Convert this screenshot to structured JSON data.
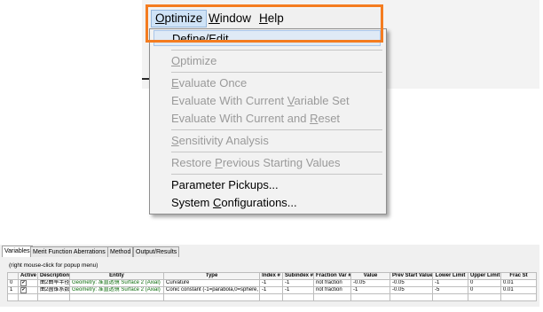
{
  "menubar": {
    "items": [
      {
        "mnemonic": "O",
        "rest": "ptimize",
        "active": true
      },
      {
        "mnemonic": "W",
        "rest": "indow",
        "active": false
      },
      {
        "mnemonic": "H",
        "rest": "elp",
        "active": false
      }
    ]
  },
  "dropdown": {
    "define_edit": "Define/Edit...",
    "optimize": {
      "mnemonic": "O",
      "rest": "ptimize"
    },
    "evaluate_once": {
      "mnemonic": "E",
      "rest": "valuate Once"
    },
    "evaluate_current_variable_set": {
      "pre": "Evaluate With Current ",
      "mnemonic": "V",
      "rest": "ariable Set"
    },
    "evaluate_current_reset": {
      "pre": "Evaluate With Current and ",
      "mnemonic": "R",
      "rest": "eset"
    },
    "sensitivity_analysis": {
      "mnemonic": "S",
      "rest": "ensitivity Analysis"
    },
    "restore_previous": {
      "pre": "Restore ",
      "mnemonic": "P",
      "rest": "revious Starting Values"
    },
    "parameter_pickups": "Parameter Pickups...",
    "system_configurations": {
      "pre": "System ",
      "mnemonic": "C",
      "rest": "onfigurations..."
    }
  },
  "panel": {
    "tabs": [
      "Variables",
      "Merit Function Aberrations",
      "Method",
      "Output/Results"
    ],
    "hint": "(right mouse-click for popup menu)",
    "columns": [
      "",
      "Active",
      "Description",
      "Entity",
      "Type",
      "Index #",
      "Subindex #",
      "Fraction Var #",
      "Value",
      "Prev Start Value",
      "Lower Limit",
      "Upper Limit",
      "Frac St"
    ],
    "rows": [
      [
        "0",
        "✔",
        "曲2曲率半径",
        "Geometry: 准直透镜 Surface 2   (Axial)",
        "Curvature",
        "-1",
        "-1",
        "not fraction",
        "-0.05",
        "-0.05",
        "-1",
        "0",
        "0.01"
      ],
      [
        "1",
        "✔",
        "曲2圆锥系数",
        "Geometry: 准直透镜 Surface 2   (Axial)",
        "Conic constant (-1=parabola,0=sphere,",
        "-1",
        "-1",
        "not fraction",
        "-1",
        "-0.05",
        "-5",
        "0",
        "0.01"
      ]
    ]
  },
  "colors": {
    "highlight_border": "#f47c20",
    "menu_selection": "#dfeaf6"
  }
}
